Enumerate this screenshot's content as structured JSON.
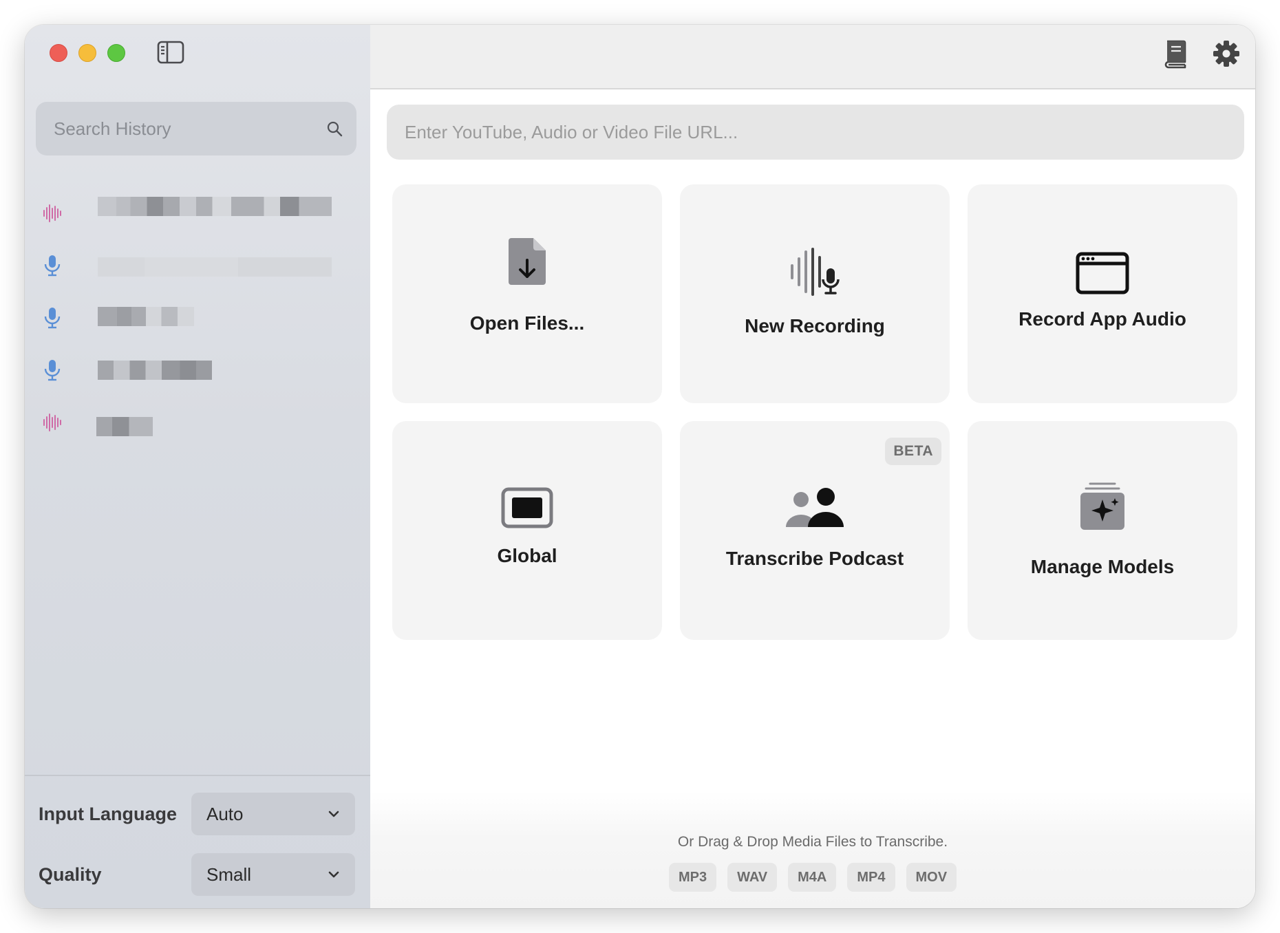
{
  "sidebar": {
    "search_placeholder": "Search History",
    "history": [
      {
        "type": "waveform"
      },
      {
        "type": "microphone"
      },
      {
        "type": "microphone"
      },
      {
        "type": "microphone"
      },
      {
        "type": "waveform"
      }
    ],
    "input_language": {
      "label": "Input Language",
      "value": "Auto"
    },
    "quality": {
      "label": "Quality",
      "value": "Small"
    }
  },
  "toolbar": {
    "icons": [
      "book-icon",
      "gear-icon"
    ]
  },
  "main": {
    "url_placeholder": "Enter YouTube, Audio or Video File URL...",
    "cards": [
      {
        "label": "Open Files...",
        "icon": "document-download-icon"
      },
      {
        "label": "New Recording",
        "icon": "waveform-microphone-icon"
      },
      {
        "label": "Record App Audio",
        "icon": "app-window-icon"
      },
      {
        "label": "Global",
        "icon": "screen-icon"
      },
      {
        "label": "Transcribe Podcast",
        "icon": "people-icon",
        "badge": "BETA"
      },
      {
        "label": "Manage Models",
        "icon": "sparkle-stack-icon"
      }
    ],
    "drag_drop_text": "Or Drag & Drop Media Files to Transcribe.",
    "formats": [
      "MP3",
      "WAV",
      "M4A",
      "MP4",
      "MOV"
    ]
  },
  "colors": {
    "close": "#ee5f57",
    "minimize": "#f6bd3b",
    "zoom": "#5dc742",
    "mic_blue": "#5a8fd6",
    "waveform_pink": "#cf6aa6"
  }
}
